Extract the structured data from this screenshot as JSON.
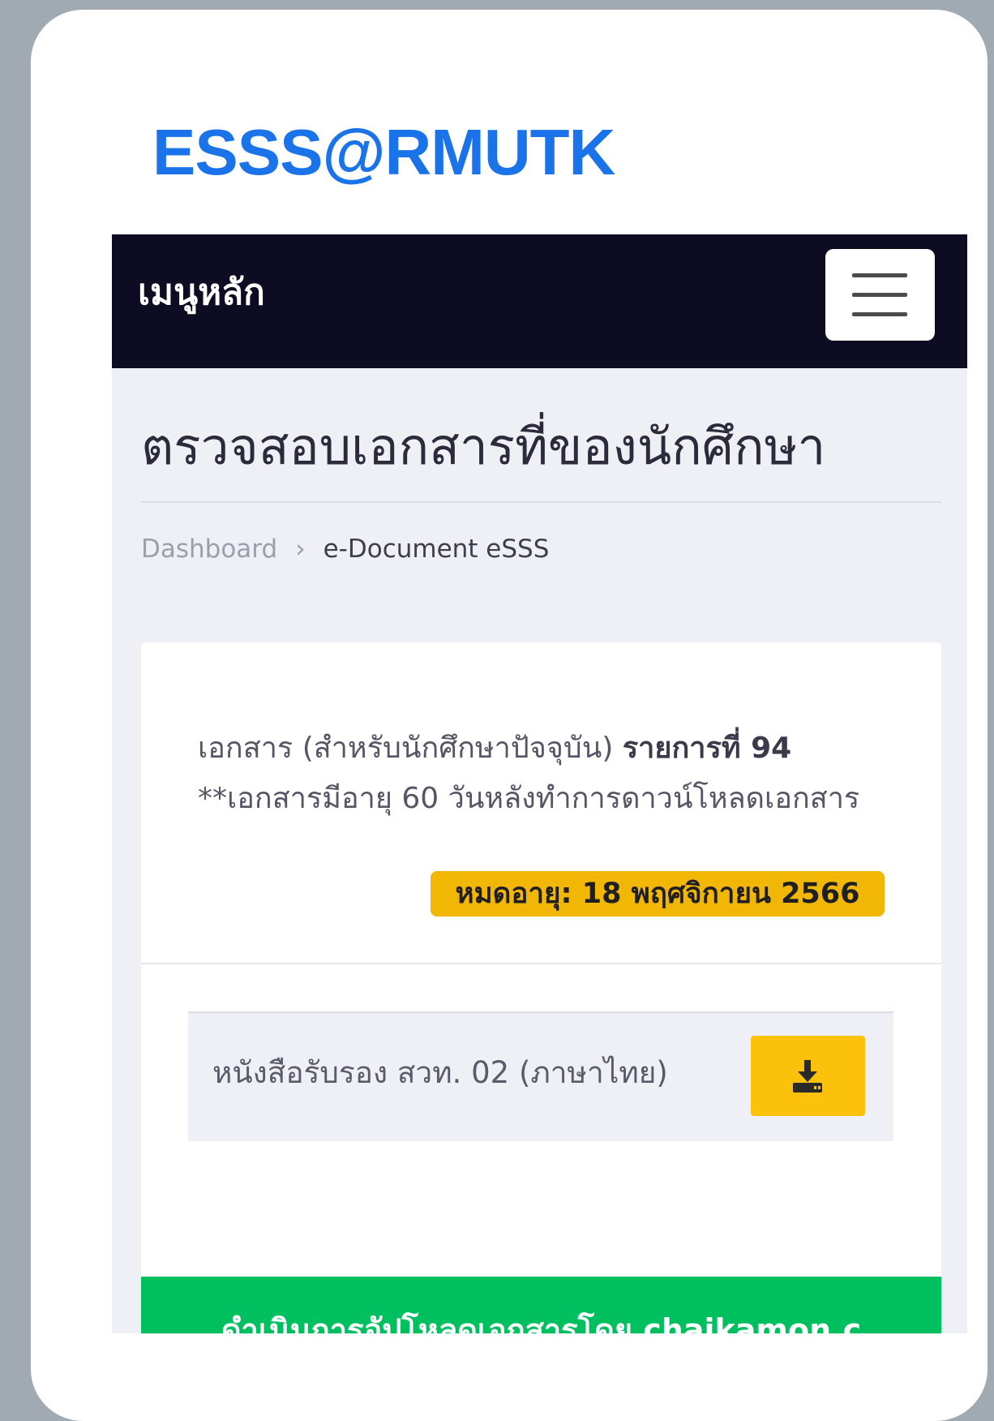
{
  "brand": {
    "logo_text": "ESSS@RMUTK",
    "color": "#1a73e8"
  },
  "navbar": {
    "title": "เมนูหลัก",
    "toggle_icon": "hamburger-menu-icon",
    "background": "#0d0c23"
  },
  "page": {
    "title": "ตรวจสอบเอกสารที่ของนักศึกษา"
  },
  "breadcrumb": {
    "items": [
      "Dashboard",
      "e-Document eSSS"
    ],
    "separator": "›"
  },
  "document_card": {
    "heading_prefix": "เอกสาร (สำหรับนักศึกษาปัจจุบัน)",
    "heading_item": "รายการที่ 94",
    "note": "**เอกสารมีอายุ 60 วันหลังทำการดาวน์โหลดเอกสาร",
    "expiry_badge": "หมดอายุ: 18 พฤศจิกายน 2566",
    "expiry_color": "#f2b705",
    "documents": [
      {
        "label": "หนังสือรับรอง สวท. 02 (ภาษาไทย)",
        "action_icon": "download-icon"
      }
    ],
    "upload_status": "ดำเนินการอัปโหลดเอกสารโดย chaikamon.c",
    "upload_color": "#00bf5f"
  }
}
